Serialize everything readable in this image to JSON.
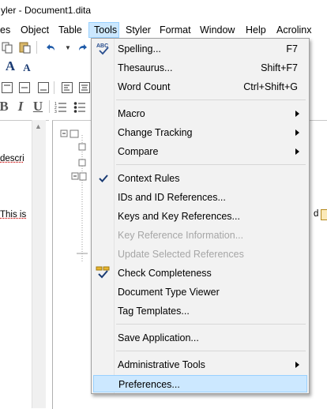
{
  "window": {
    "title": "yler - Document1.dita"
  },
  "menubar": {
    "items": [
      {
        "label": "es"
      },
      {
        "label": "Object"
      },
      {
        "label": "Table"
      },
      {
        "label": "Tools"
      },
      {
        "label": "Styler"
      },
      {
        "label": "Format"
      },
      {
        "label": "Window"
      },
      {
        "label": "Help"
      },
      {
        "label": "Acrolinx"
      }
    ]
  },
  "toolbar": {
    "font_size_big": "A",
    "font_size_small": "A",
    "bold": "B",
    "italic": "I",
    "underline": "U"
  },
  "document": {
    "line1": "descri",
    "line2": "This is",
    "line3": "d"
  },
  "tools_menu": {
    "items": [
      {
        "label": "Spelling...",
        "shortcut": "F7"
      },
      {
        "label": "Thesaurus...",
        "shortcut": "Shift+F7"
      },
      {
        "label": "Word Count",
        "shortcut": "Ctrl+Shift+G"
      },
      {
        "label": "Macro"
      },
      {
        "label": "Change Tracking"
      },
      {
        "label": "Compare"
      },
      {
        "label": "Context Rules"
      },
      {
        "label": "IDs and ID References..."
      },
      {
        "label": "Keys and Key References..."
      },
      {
        "label": "Key Reference Information..."
      },
      {
        "label": "Update Selected References"
      },
      {
        "label": "Check Completeness"
      },
      {
        "label": "Document Type Viewer"
      },
      {
        "label": "Tag Templates..."
      },
      {
        "label": "Save Application..."
      },
      {
        "label": "Administrative Tools"
      },
      {
        "label": "Preferences..."
      }
    ],
    "spelling_icon_text": "ABC"
  }
}
